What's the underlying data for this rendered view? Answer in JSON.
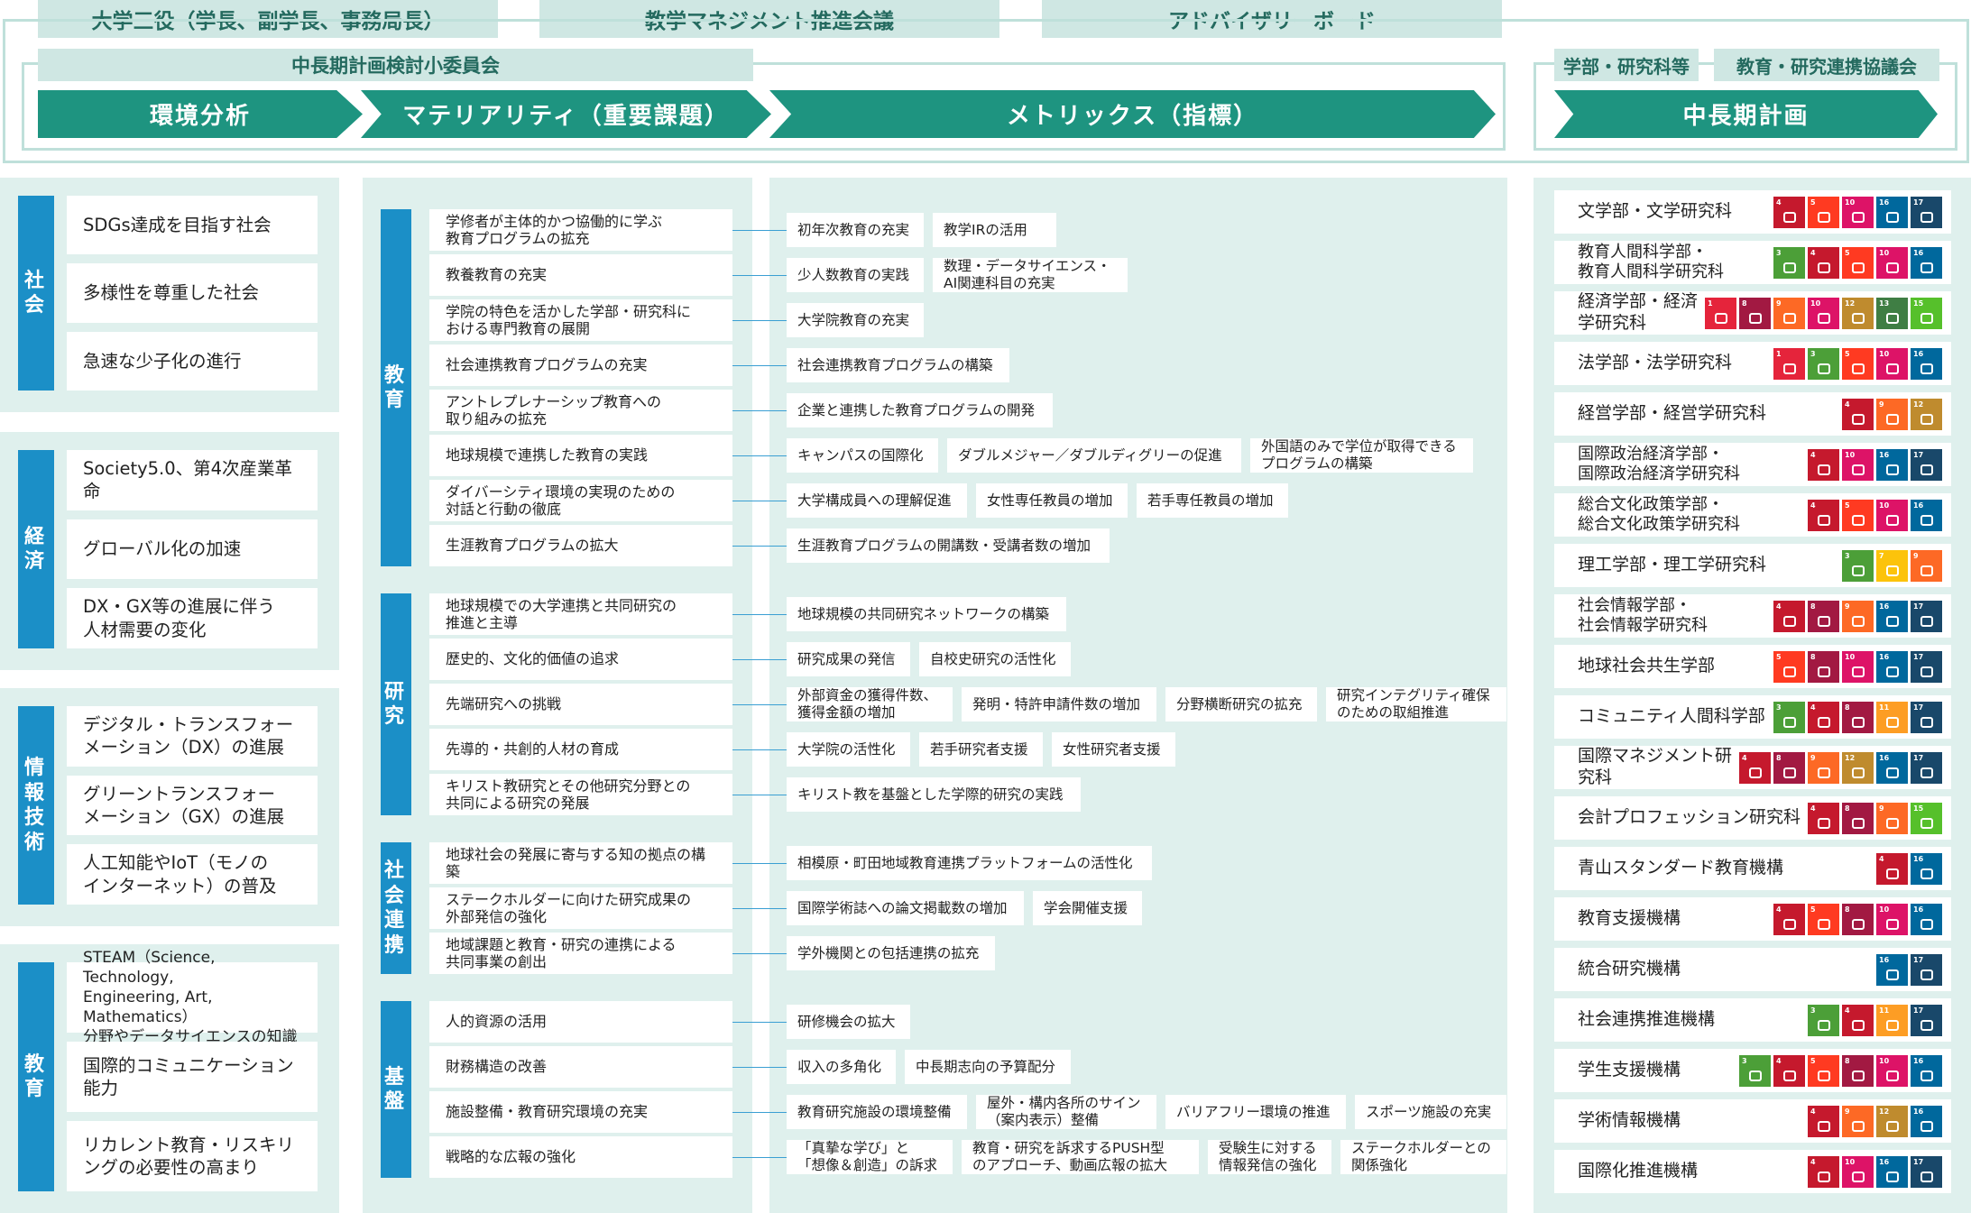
{
  "top_headers": [
    "大学三役（学長、副学長、事務局長）",
    "教学マネジメント推進会議",
    "アドバイザリーボード"
  ],
  "committee": "中長期計画検討小委員会",
  "right_headers": [
    "学部・研究科等",
    "教育・研究連携協議会"
  ],
  "arrows": [
    "環境分析",
    "マテリアリティ（重要課題）",
    "メトリックス（指標）",
    "中長期計画"
  ],
  "env": [
    {
      "label": "社\n会",
      "items": [
        "SDGs達成を目指す社会",
        "多様性を尊重した社会",
        "急速な少子化の進行"
      ]
    },
    {
      "label": "経\n済",
      "items": [
        "Society5.0、第4次産業革命",
        "グローバル化の加速",
        "DX・GX等の進展に伴う\n人材需要の変化"
      ]
    },
    {
      "label": "情\n報\n技\n術",
      "items": [
        "デジタル・トランスフォー\nメーション（DX）の進展",
        "グリーントランスフォー\nメーション（GX）の進展",
        "人工知能やIoT（モノの\nインターネット）の普及"
      ]
    },
    {
      "label": "教\n育",
      "items": [
        "STEAM（Science, Technology,\nEngineering, Art, Mathematics）\n分野やデータサイエンスの知識",
        "国際的コミュニケーション\n能力",
        "リカレント教育・リスキリ\nングの必要性の高まり"
      ]
    }
  ],
  "materiality": [
    {
      "label": "教育",
      "rows": [
        {
          "text": "学修者が主体的かつ協働的に学ぶ\n教育プログラムの拡充",
          "metrics": [
            "初年次教育の充実",
            "教学IRの活用"
          ]
        },
        {
          "text": "教養教育の充実",
          "metrics": [
            "少人数教育の実践",
            "数理・データサイエンス・\nAI関連科目の充実"
          ]
        },
        {
          "text": "学院の特色を活かした学部・研究科に\nおける専門教育の展開",
          "metrics": [
            "大学院教育の充実"
          ]
        },
        {
          "text": "社会連携教育プログラムの充実",
          "metrics": [
            "社会連携教育プログラムの構築"
          ]
        },
        {
          "text": "アントレプレナーシップ教育への\n取り組みの拡充",
          "metrics": [
            "企業と連携した教育プログラムの開発"
          ]
        },
        {
          "text": "地球規模で連携した教育の実践",
          "metrics": [
            "キャンパスの国際化",
            "ダブルメジャー／ダブルディグリーの促進",
            "外国語のみで学位が取得できる\nプログラムの構築"
          ]
        },
        {
          "text": "ダイバーシティ環境の実現のための\n対話と行動の徹底",
          "metrics": [
            "大学構成員への理解促進",
            "女性専任教員の増加",
            "若手専任教員の増加"
          ]
        },
        {
          "text": "生涯教育プログラムの拡大",
          "metrics": [
            "生涯教育プログラムの開講数・受講者数の増加"
          ]
        }
      ]
    },
    {
      "label": "研究",
      "rows": [
        {
          "text": "地球規模での大学連携と共同研究の\n推進と主導",
          "metrics": [
            "地球規模の共同研究ネットワークの構築"
          ]
        },
        {
          "text": "歴史的、文化的価値の追求",
          "metrics": [
            "研究成果の発信",
            "自校史研究の活性化"
          ]
        },
        {
          "text": "先端研究への挑戦",
          "metrics": [
            "外部資金の獲得件数、\n獲得金額の増加",
            "発明・特許申請件数の増加",
            "分野横断研究の拡充",
            "研究インテグリティ確保\nのための取組推進"
          ]
        },
        {
          "text": "先導的・共創的人材の育成",
          "metrics": [
            "大学院の活性化",
            "若手研究者支援",
            "女性研究者支援"
          ]
        },
        {
          "text": "キリスト教研究とその他研究分野との\n共同による研究の発展",
          "metrics": [
            "キリスト教を基盤とした学際的研究の実践"
          ]
        }
      ]
    },
    {
      "label": "社会連携",
      "rows": [
        {
          "text": "地球社会の発展に寄与する知の拠点の構築",
          "metrics": [
            "相模原・町田地域教育連携プラットフォームの活性化"
          ]
        },
        {
          "text": "ステークホルダーに向けた研究成果の\n外部発信の強化",
          "metrics": [
            "国際学術誌への論文掲載数の増加",
            "学会開催支援"
          ]
        },
        {
          "text": "地域課題と教育・研究の連携による\n共同事業の創出",
          "metrics": [
            "学外機関との包括連携の拡充"
          ]
        }
      ]
    },
    {
      "label": "基盤",
      "rows": [
        {
          "text": "人的資源の活用",
          "metrics": [
            "研修機会の拡大"
          ]
        },
        {
          "text": "財務構造の改善",
          "metrics": [
            "収入の多角化",
            "中長期志向の予算配分"
          ]
        },
        {
          "text": "施設整備・教育研究環境の充実",
          "metrics": [
            "教育研究施設の環境整備",
            "屋外・構内各所のサイン\n（案内表示）整備",
            "バリアフリー環境の推進",
            "スポーツ施設の充実"
          ]
        },
        {
          "text": "戦略的な広報の強化",
          "metrics": [
            "「真摯な学び」と\n「想像＆創造」の訴求",
            "教育・研究を訴求するPUSH型\nのアプローチ、動画広報の拡大",
            "受験生に対する\n情報発信の強化",
            "ステークホルダーとの\n関係強化"
          ]
        }
      ]
    }
  ],
  "plan": [
    {
      "name": "文学部・文学研究科",
      "sdgs": [
        4,
        5,
        10,
        16,
        17
      ]
    },
    {
      "name": "教育人間科学部・\n教育人間科学研究科",
      "sdgs": [
        3,
        4,
        5,
        10,
        16
      ]
    },
    {
      "name": "経済学部・経済学研究科",
      "sdgs": [
        1,
        8,
        9,
        10,
        12,
        13,
        15
      ]
    },
    {
      "name": "法学部・法学研究科",
      "sdgs": [
        1,
        3,
        5,
        10,
        16
      ]
    },
    {
      "name": "経営学部・経営学研究科",
      "sdgs": [
        4,
        9,
        12
      ]
    },
    {
      "name": "国際政治経済学部・\n国際政治経済学研究科",
      "sdgs": [
        4,
        10,
        16,
        17
      ]
    },
    {
      "name": "総合文化政策学部・\n総合文化政策学研究科",
      "sdgs": [
        4,
        5,
        10,
        16
      ]
    },
    {
      "name": "理工学部・理工学研究科",
      "sdgs": [
        3,
        7,
        9
      ]
    },
    {
      "name": "社会情報学部・\n社会情報学研究科",
      "sdgs": [
        4,
        8,
        9,
        16,
        17
      ]
    },
    {
      "name": "地球社会共生学部",
      "sdgs": [
        5,
        8,
        10,
        16,
        17
      ]
    },
    {
      "name": "コミュニティ人間科学部",
      "sdgs": [
        3,
        4,
        8,
        11,
        17
      ]
    },
    {
      "name": "国際マネジメント研究科",
      "sdgs": [
        4,
        8,
        9,
        12,
        16,
        17
      ]
    },
    {
      "name": "会計プロフェッション研究科",
      "sdgs": [
        4,
        8,
        9,
        15
      ]
    },
    {
      "name": "青山スタンダード教育機構",
      "sdgs": [
        4,
        16
      ]
    },
    {
      "name": "教育支援機構",
      "sdgs": [
        4,
        5,
        8,
        10,
        16
      ]
    },
    {
      "name": "統合研究機構",
      "sdgs": [
        16,
        17
      ]
    },
    {
      "name": "社会連携推進機構",
      "sdgs": [
        3,
        4,
        11,
        17
      ]
    },
    {
      "name": "学生支援機構",
      "sdgs": [
        3,
        4,
        5,
        8,
        10,
        16
      ]
    },
    {
      "name": "学術情報機構",
      "sdgs": [
        4,
        9,
        12,
        16
      ]
    },
    {
      "name": "国際化推進機構",
      "sdgs": [
        4,
        10,
        16,
        17
      ]
    }
  ],
  "sdg_colors": {
    "1": "#e5243b",
    "2": "#dda63a",
    "3": "#4c9f38",
    "4": "#c5192d",
    "5": "#ff3a21",
    "6": "#26bde2",
    "7": "#fcc30b",
    "8": "#a21942",
    "9": "#fd6925",
    "10": "#dd1367",
    "11": "#fd9d24",
    "12": "#bf8b2e",
    "13": "#3f7e44",
    "14": "#0a97d9",
    "15": "#56c02b",
    "16": "#00689d",
    "17": "#19486a"
  },
  "colors": {
    "arrow": "#1e9480",
    "header_bg": "#cfe7e3",
    "panel_bg": "#dff0ed",
    "category": "#1b8fc7"
  }
}
